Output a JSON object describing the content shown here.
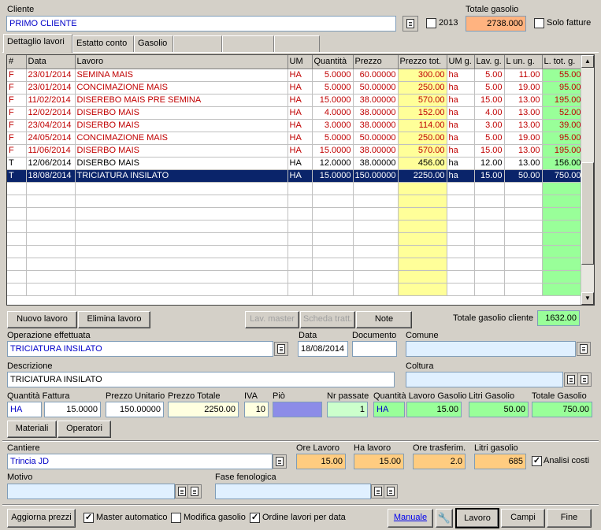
{
  "header": {
    "cliente_label": "Cliente",
    "cliente_value": "PRIMO CLIENTE",
    "year_label": "2013",
    "totale_gasolio_label": "Totale gasolio",
    "totale_gasolio_value": "2738.000",
    "solo_fatture_label": "Solo fatture"
  },
  "tabs": [
    {
      "label": "Dettaglio lavori",
      "active": true
    },
    {
      "label": "Estatto conto"
    },
    {
      "label": "Gasolio"
    },
    {
      "label": ""
    },
    {
      "label": ""
    },
    {
      "label": ""
    }
  ],
  "grid": {
    "columns": [
      "#",
      "Data",
      "Lavoro",
      "UM",
      "Quantità",
      "Prezzo",
      "Prezzo tot.",
      "UM g.",
      "Lav. g.",
      "L un. g.",
      "L. tot. g."
    ],
    "rows": [
      [
        "F",
        "23/01/2014",
        "SEMINA MAIS",
        "HA",
        "5.0000",
        "60.00000",
        "300.00",
        "ha",
        "5.00",
        "11.00",
        "55.00"
      ],
      [
        "F",
        "23/01/2014",
        "CONCIMAZIONE MAIS",
        "HA",
        "5.0000",
        "50.00000",
        "250.00",
        "ha",
        "5.00",
        "19.00",
        "95.00"
      ],
      [
        "F",
        "11/02/2014",
        "DISEREBO MAIS PRE SEMINA",
        "HA",
        "15.0000",
        "38.00000",
        "570.00",
        "ha",
        "15.00",
        "13.00",
        "195.00"
      ],
      [
        "F",
        "12/02/2014",
        "DISERBO MAIS",
        "HA",
        "4.0000",
        "38.00000",
        "152.00",
        "ha",
        "4.00",
        "13.00",
        "52.00"
      ],
      [
        "F",
        "23/04/2014",
        "DISERBO MAIS",
        "HA",
        "3.0000",
        "38.00000",
        "114.00",
        "ha",
        "3.00",
        "13.00",
        "39.00"
      ],
      [
        "F",
        "24/05/2014",
        "CONCIMAZIONE MAIS",
        "HA",
        "5.0000",
        "50.00000",
        "250.00",
        "ha",
        "5.00",
        "19.00",
        "95.00"
      ],
      [
        "F",
        "11/06/2014",
        "DISERBO MAIS",
        "HA",
        "15.0000",
        "38.00000",
        "570.00",
        "ha",
        "15.00",
        "13.00",
        "195.00"
      ],
      [
        "T",
        "12/06/2014",
        "DISERBO MAIS",
        "HA",
        "12.0000",
        "38.00000",
        "456.00",
        "ha",
        "12.00",
        "13.00",
        "156.00"
      ],
      [
        "T",
        "18/08/2014",
        "TRICIATURA INSILATO",
        "HA",
        "15.0000",
        "150.00000",
        "2250.00",
        "ha",
        "15.00",
        "50.00",
        "750.00"
      ]
    ]
  },
  "buttons": {
    "nuovo_lavoro": "Nuovo lavoro",
    "elimina_lavoro": "Elimina lavoro",
    "lav_master": "Lav. master",
    "scheda_tratt": "Scheda tratt.",
    "note": "Note",
    "materiali": "Materiali",
    "operatori": "Operatori",
    "aggiorna_prezzi": "Aggiorna prezzi",
    "manuale": "Manuale",
    "lavoro": "Lavoro",
    "campi": "Campi",
    "fine": "Fine"
  },
  "totale_gasolio_cliente": {
    "label": "Totale gasolio cliente",
    "value": "1632.00"
  },
  "form": {
    "operazione_label": "Operazione effettuata",
    "operazione_value": "TRICIATURA INSILATO",
    "data_label": "Data",
    "data_value": "18/08/2014",
    "documento_label": "Documento",
    "documento_value": "",
    "comune_label": "Comune",
    "comune_value": "",
    "descrizione_label": "Descrizione",
    "descrizione_value": "TRICIATURA INSILATO",
    "coltura_label": "Coltura",
    "coltura_value": "",
    "quantita_fattura_label": "Quantità Fattura",
    "qf_um": "HA",
    "qf_value": "15.0000",
    "prezzo_unitario_label": "Prezzo Unitario",
    "prezzo_unitario_value": "150.00000",
    "prezzo_totale_label": "Prezzo Totale",
    "prezzo_totale_value": "2250.00",
    "iva_label": "IVA",
    "iva_value": "10",
    "pio_label": "Piò",
    "pio_value": "",
    "nr_passate_label": "Nr passate",
    "nr_passate_value": "1",
    "qlg_label": "Quantità Lavoro Gasolio",
    "qlg_um": "HA",
    "qlg_value": "15.00",
    "litri_gasolio_label": "Litri Gasolio",
    "litri_gasolio_value": "50.00",
    "totale_gasolio_label": "Totale Gasolio",
    "totale_gasolio_value": "750.00",
    "cantiere_label": "Cantiere",
    "cantiere_value": "Trincia JD",
    "ore_lavoro_label": "Ore Lavoro",
    "ore_lavoro_value": "15.00",
    "ha_lavoro_label": "Ha lavoro",
    "ha_lavoro_value": "15.00",
    "ore_trasferim_label": "Ore trasferim.",
    "ore_trasferim_value": "2.0",
    "litri_gasolio2_label": "Litri gasolio",
    "litri_gasolio2_value": "685",
    "analisi_costi_label": "Analisi costi",
    "motivo_label": "Motivo",
    "motivo_value": "",
    "fase_label": "Fase fenologica",
    "fase_value": ""
  },
  "footer": {
    "master_automatico": "Master automatico",
    "modifica_gasolio": "Modifica gasolio",
    "ordine_lavori": "Ordine lavori per data"
  }
}
